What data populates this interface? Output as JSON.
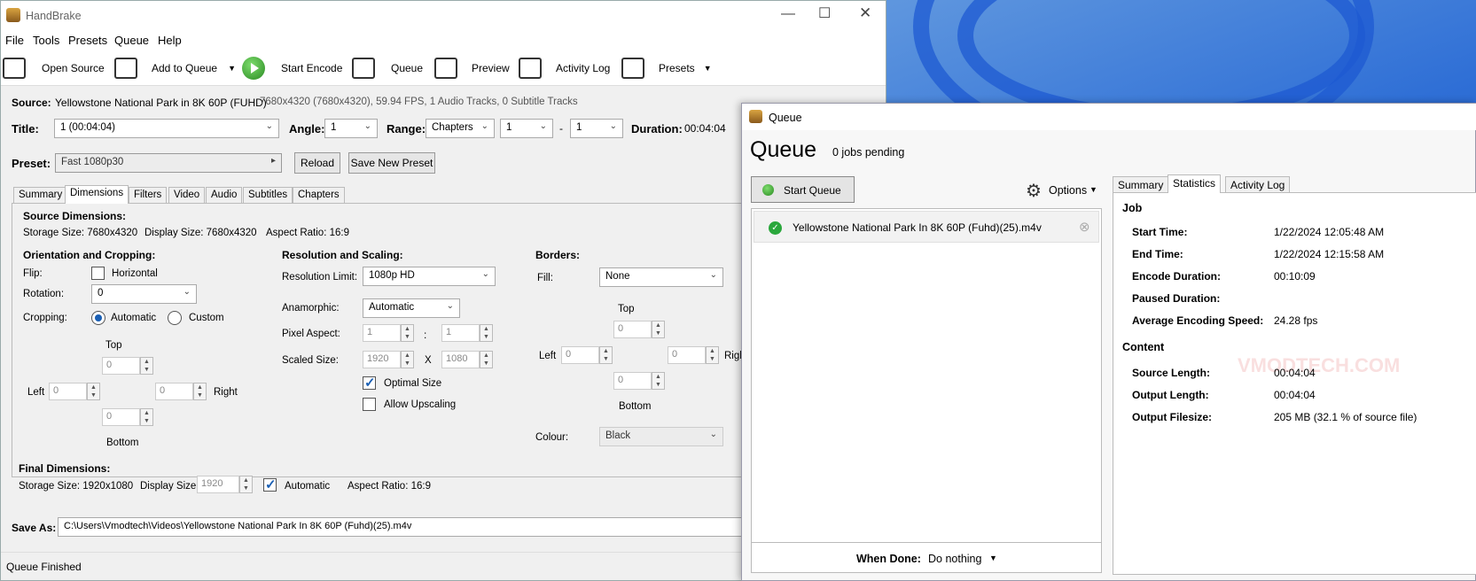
{
  "main": {
    "title": "HandBrake",
    "menu": [
      "File",
      "Tools",
      "Presets",
      "Queue",
      "Help"
    ],
    "toolbar": {
      "open_source": "Open Source",
      "add_to_queue": "Add to Queue",
      "start_encode": "Start Encode",
      "queue": "Queue",
      "preview": "Preview",
      "activity_log": "Activity Log",
      "presets": "Presets"
    },
    "source_label": "Source:",
    "source_name": "Yellowstone National Park in 8K 60P (FUHD)",
    "source_info": "7680x4320 (7680x4320), 59.94 FPS, 1 Audio Tracks, 0 Subtitle Tracks",
    "title_label": "Title:",
    "title_value": "1  (00:04:04)",
    "angle_label": "Angle:",
    "angle_value": "1",
    "range_label": "Range:",
    "range_type": "Chapters",
    "range_from": "1",
    "range_dash": "-",
    "range_to": "1",
    "duration_label": "Duration:",
    "duration_value": "00:04:04",
    "preset_label": "Preset:",
    "preset_value": "Fast 1080p30",
    "reload": "Reload",
    "save_new_preset": "Save New Preset",
    "tabs": [
      "Summary",
      "Dimensions",
      "Filters",
      "Video",
      "Audio",
      "Subtitles",
      "Chapters"
    ],
    "dims": {
      "source_dimensions": "Source Dimensions:",
      "storage_size": "Storage Size: 7680x4320",
      "display_size": "Display Size: 7680x4320",
      "aspect_ratio": "Aspect Ratio: 16:9",
      "orientation": "Orientation and Cropping:",
      "flip": "Flip:",
      "horizontal": "Horizontal",
      "rotation": "Rotation:",
      "rotation_value": "0",
      "cropping": "Cropping:",
      "automatic": "Automatic",
      "custom": "Custom",
      "top": "Top",
      "left": "Left",
      "right": "Right",
      "bottom": "Bottom",
      "crop_top": "0",
      "crop_left": "0",
      "crop_right": "0",
      "crop_bottom": "0",
      "resolution": "Resolution and Scaling:",
      "res_limit": "Resolution Limit:",
      "res_limit_value": "1080p HD",
      "anamorphic": "Anamorphic:",
      "anamorphic_value": "Automatic",
      "pixel_aspect": "Pixel Aspect:",
      "pa_w": "1",
      "pa_colon": ":",
      "pa_h": "1",
      "scaled_size": "Scaled Size:",
      "scaled_w": "1920",
      "scaled_x": "X",
      "scaled_h": "1080",
      "optimal_size": "Optimal Size",
      "allow_upscaling": "Allow Upscaling",
      "borders": "Borders:",
      "fill": "Fill:",
      "fill_value": "None",
      "b_top": "0",
      "b_left": "0",
      "b_right": "0",
      "b_bottom": "0",
      "colour": "Colour:",
      "colour_value": "Black",
      "final_dimensions": "Final Dimensions:",
      "final_storage": "Storage Size: 1920x1080",
      "final_display_label": "Display Size:",
      "final_display_value": "1920",
      "final_auto": "Automatic",
      "final_aspect": "Aspect Ratio: 16:9"
    },
    "save_as_label": "Save As:",
    "save_as_value": "C:\\Users\\Vmodtech\\Videos\\Yellowstone National Park In 8K 60P (Fuhd)(25).m4v",
    "status": "Queue Finished"
  },
  "queue": {
    "window_title": "Queue",
    "heading": "Queue",
    "pending": "0 jobs pending",
    "start_queue": "Start Queue",
    "options": "Options",
    "item": "Yellowstone National Park In 8K 60P (Fuhd)(25).m4v",
    "when_done_label": "When Done:",
    "when_done_value": "Do nothing",
    "tabs": [
      "Summary",
      "Statistics",
      "Activity Log"
    ],
    "job": "Job",
    "start_time_label": "Start Time:",
    "start_time": "1/22/2024 12:05:48 AM",
    "end_time_label": "End Time:",
    "end_time": "1/22/2024 12:15:58 AM",
    "encode_duration_label": "Encode Duration:",
    "encode_duration": "00:10:09",
    "paused_duration_label": "Paused Duration:",
    "avg_speed_label": "Average Encoding Speed:",
    "avg_speed": "24.28 fps",
    "content": "Content",
    "source_length_label": "Source Length:",
    "source_length": "00:04:04",
    "output_length_label": "Output Length:",
    "output_length": "00:04:04",
    "output_filesize_label": "Output Filesize:",
    "output_filesize": "205 MB (32.1 % of source file)",
    "watermark": "VMODTECH.COM"
  }
}
